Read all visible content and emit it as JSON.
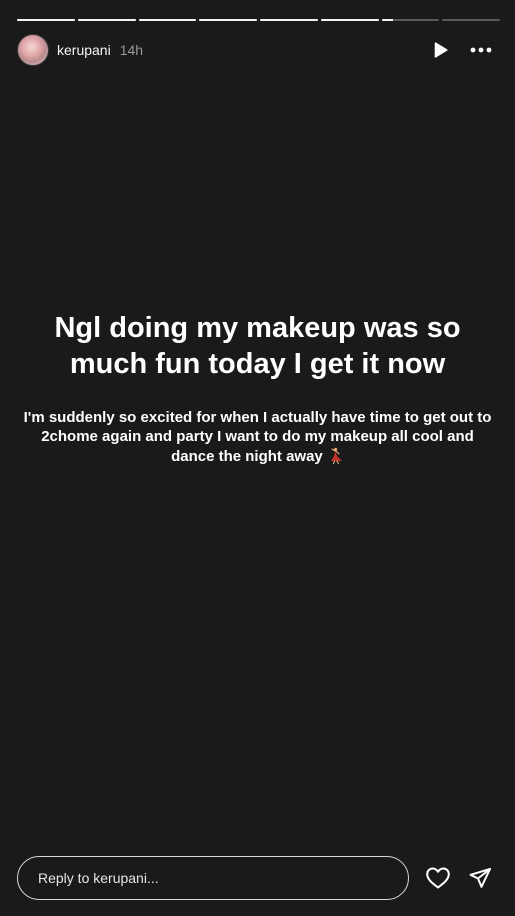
{
  "story": {
    "progress": {
      "segment_count": 8,
      "fill_fractions": [
        1,
        1,
        1,
        1,
        1,
        1,
        0.2,
        0
      ]
    },
    "header": {
      "username": "kerupani",
      "time": "14h",
      "avatar_icon": "avatar-photo",
      "play_icon": "play-icon",
      "more_icon": "more-options-icon"
    },
    "content": {
      "title": "Ngl doing my makeup was so much fun today I get it now",
      "body": "I'm suddenly so excited for when I actually have time to get out to 2chome again and party I want to do my makeup all cool and dance the night away",
      "emoji_icon": "dancer-emoji-icon"
    },
    "footer": {
      "reply_placeholder": "Reply to kerupani...",
      "like_icon": "heart-icon",
      "share_icon": "send-icon"
    }
  },
  "colors": {
    "background": "#1a1a1a",
    "text": "#ffffff",
    "muted": "#9a9a9a",
    "progress_track": "#5a5a5a",
    "progress_fill": "#f2f2f2",
    "dancer_dress": "#c0322b",
    "dancer_skin": "#e8b27a"
  }
}
